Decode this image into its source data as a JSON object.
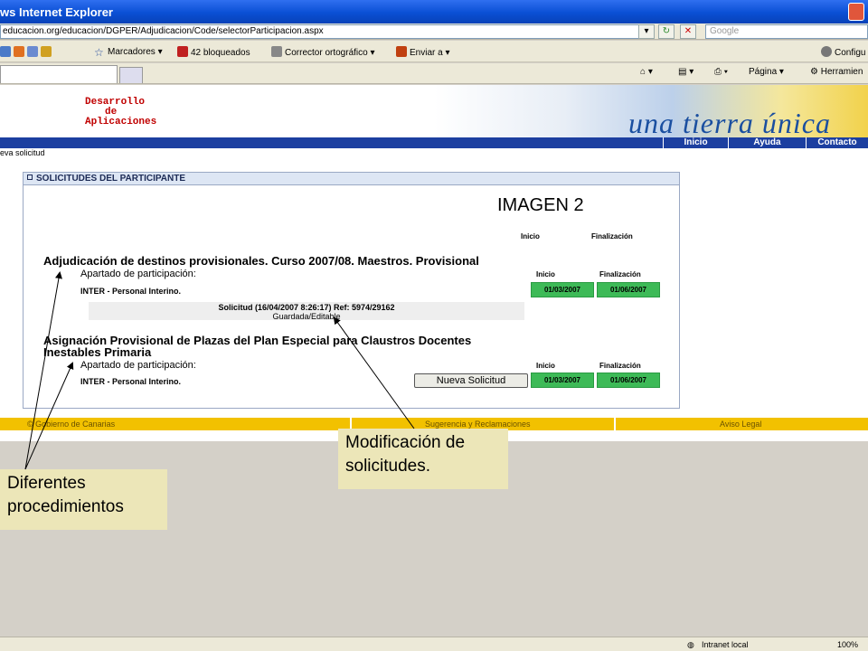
{
  "window": {
    "title": "ws Internet Explorer"
  },
  "address": {
    "url": "educacion.org/educacion/DGPER/Adjudicacion/Code/selectorParticipacion.aspx",
    "search_placeholder": "Google"
  },
  "toolbar": {
    "bookmarks": "Marcadores",
    "blocked": "42 bloqueados",
    "spellcheck": "Corrector ortográfico",
    "send": "Enviar a",
    "config": "Configu",
    "page": "Página",
    "tools": "Herramien"
  },
  "banner": {
    "title_lines": [
      "Desarrollo",
      "de",
      "Aplicaciones"
    ],
    "slogan": "una tierra única"
  },
  "nav": {
    "items": [
      "Inicio",
      "Ayuda",
      "Contacto"
    ]
  },
  "breadcrumb": "eva solicitud",
  "panel": {
    "title": "SOLICITUDES DEL PARTICIPANTE",
    "header_inicio": "Inicio",
    "header_finalizacion": "Finalización",
    "procedures": [
      {
        "title": "Adjudicación de destinos provisionales. Curso 2007/08. Maestros. Provisional",
        "apartado": "Apartado de participación:",
        "inicio_label": "Inicio",
        "fin_label": "Finalización",
        "personal": "INTER - Personal Interino.",
        "start": "01/03/2007",
        "end": "01/06/2007",
        "solicitud_line1": "Solicitud (16/04/2007 8:26:17) Ref: 5974/29162",
        "solicitud_line2": "Guardada/Editable"
      },
      {
        "title_line1": "Asignación Provisional de Plazas del Plan Especial para Claustros Docentes",
        "title_line2": "Inestables Primaria",
        "apartado": "Apartado de participación:",
        "inicio_label": "Inicio",
        "fin_label": "Finalización",
        "personal": "INTER - Personal Interino.",
        "button": "Nueva Solicitud",
        "start": "01/03/2007",
        "end": "01/06/2007"
      }
    ]
  },
  "annotation": {
    "image_label": "IMAGEN 2"
  },
  "footer": {
    "copyright": "© Gobierno de Canarias",
    "suggestions": "Sugerencia y Reclamaciones",
    "legal": "Aviso Legal"
  },
  "callouts": {
    "modification": [
      "Modificación de",
      "solicitudes."
    ],
    "procedures": [
      "Diferentes",
      "procedimientos"
    ]
  },
  "status": {
    "zone": "Intranet local",
    "zoom": "100%"
  },
  "colors": {
    "nav": "#1c3fa0",
    "footer": "#f2c100",
    "date_box": "#3dba57",
    "callout_bg": "#ece6b8"
  }
}
